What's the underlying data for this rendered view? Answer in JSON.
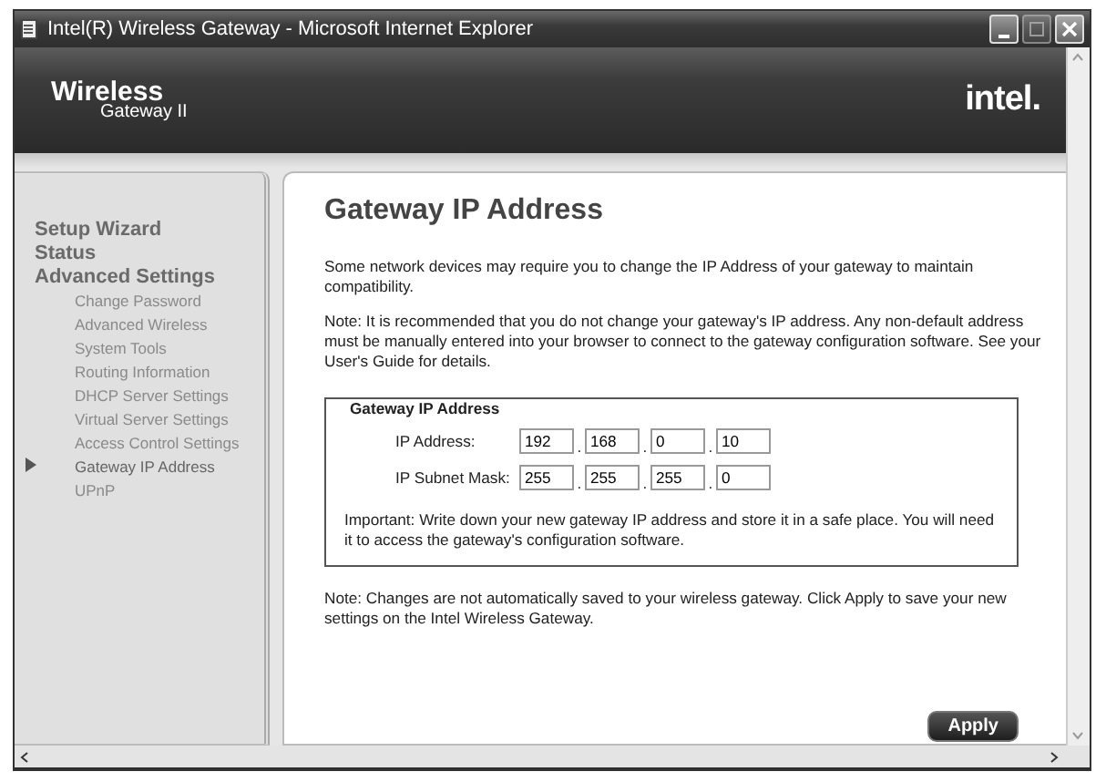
{
  "window": {
    "title": "Intel(R) Wireless Gateway - Microsoft Internet Explorer",
    "controls": [
      {
        "kind": "minimize",
        "disabled": false
      },
      {
        "kind": "maximize",
        "disabled": true
      },
      {
        "kind": "close",
        "disabled": false
      }
    ]
  },
  "header": {
    "product": "Wireless",
    "subtitle": "Gateway II",
    "brand": "intel."
  },
  "sidebar": {
    "items": [
      {
        "label": "Setup Wizard",
        "selected": false
      },
      {
        "label": "Status",
        "selected": false
      },
      {
        "label": "Advanced Settings",
        "selected": false,
        "children": [
          {
            "label": "Change Password",
            "selected": false
          },
          {
            "label": "Advanced Wireless",
            "selected": false
          },
          {
            "label": "System Tools",
            "selected": false
          },
          {
            "label": "Routing Information",
            "selected": false
          },
          {
            "label": "DHCP Server Settings",
            "selected": false
          },
          {
            "label": "Virtual Server Settings",
            "selected": false
          },
          {
            "label": "Access Control Settings",
            "selected": false
          },
          {
            "label": "Gateway IP Address",
            "selected": true
          },
          {
            "label": "UPnP",
            "selected": false
          }
        ]
      }
    ]
  },
  "page": {
    "title": "Gateway IP Address",
    "paragraphs": [
      "Some network devices may require you to change the IP Address of your gateway to maintain compatibility.",
      "Note: It is recommended that you do not change your gateway's IP address. Any non-default address must be manually entered into your browser to connect to the gateway configuration software. See your User's Guide for details."
    ],
    "fieldset": {
      "legend": "Gateway IP Address",
      "rows": [
        {
          "label": "IP Address:",
          "octets": [
            "192",
            "168",
            "0",
            "10"
          ],
          "separators": [
            ".",
            ".",
            "."
          ]
        },
        {
          "label": "IP Subnet Mask:",
          "octets": [
            "255",
            "255",
            "255",
            "0"
          ],
          "separators": [
            ".",
            ".",
            "."
          ]
        }
      ],
      "important": "Important: Write down your new gateway IP address and store it in a safe place. You will need it to access the gateway's configuration software."
    },
    "footer_note": "Note: Changes are not automatically saved to your wireless gateway. Click Apply to save your new settings on the Intel Wireless Gateway.",
    "apply_button": "Apply"
  }
}
